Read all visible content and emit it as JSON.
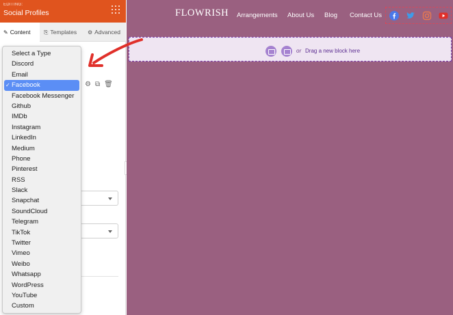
{
  "panel": {
    "editing_label": "EDITING:",
    "title": "Social Profiles",
    "tabs": [
      {
        "label": "Content",
        "icon": "pencil-icon"
      },
      {
        "label": "Templates",
        "icon": "paint-roller-icon"
      },
      {
        "label": "Advanced",
        "icon": "sliders-icon"
      }
    ]
  },
  "dropdown": {
    "selected": "Facebook",
    "items": [
      "Select a Type",
      "Discord",
      "Email",
      "Facebook",
      "Facebook Messenger",
      "Github",
      "IMDb",
      "Instagram",
      "LinkedIn",
      "Medium",
      "Phone",
      "Pinterest",
      "RSS",
      "Slack",
      "Snapchat",
      "SoundCloud",
      "Telegram",
      "TikTok",
      "Twitter",
      "Vimeo",
      "Weibo",
      "Whatsapp",
      "WordPress",
      "YouTube",
      "Custom"
    ]
  },
  "site": {
    "logo": "FLOWRISH",
    "nav": [
      "Arrangements",
      "About Us",
      "Blog",
      "Contact Us"
    ],
    "social_icons": [
      "facebook-icon",
      "twitter-icon",
      "instagram-icon",
      "youtube-icon"
    ]
  },
  "dropzone": {
    "or": "or",
    "text": "Drag a new block here"
  },
  "colors": {
    "header_orange": "#e0541e",
    "canvas": "#9a6080",
    "selected_blue": "#5b8ef5",
    "arrow_red": "#e0302a"
  }
}
